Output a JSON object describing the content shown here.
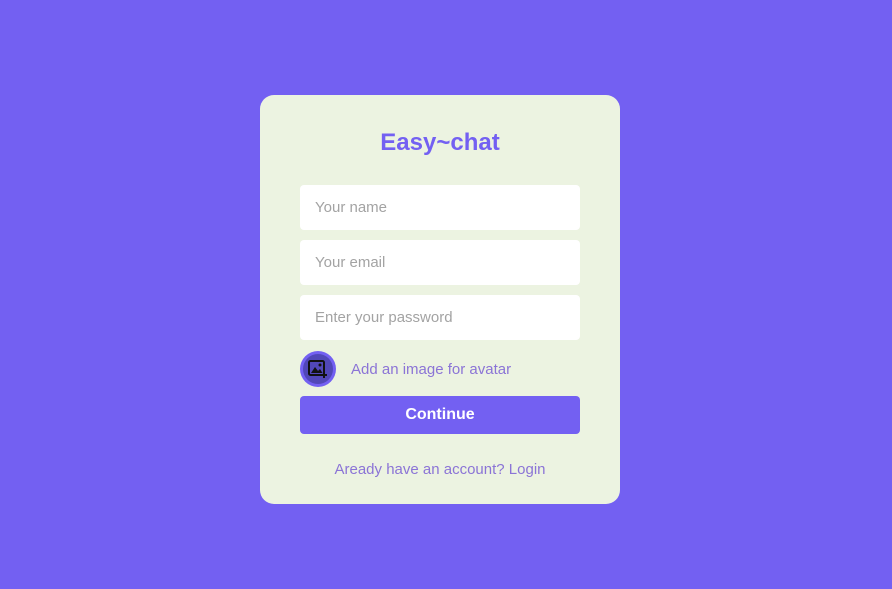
{
  "app": {
    "title": "Easy~chat"
  },
  "form": {
    "name_placeholder": "Your name",
    "email_placeholder": "Your email",
    "password_placeholder": "Enter your password",
    "avatar_icon": "add-image-icon",
    "avatar_label": "Add an image for avatar",
    "continue_label": "Continue",
    "login_prompt": "Aready have an account? Login"
  },
  "colors": {
    "background": "#7360f2",
    "card": "#ecf3e1",
    "accent": "#7360f2",
    "secondary_text": "#8b74d6"
  }
}
